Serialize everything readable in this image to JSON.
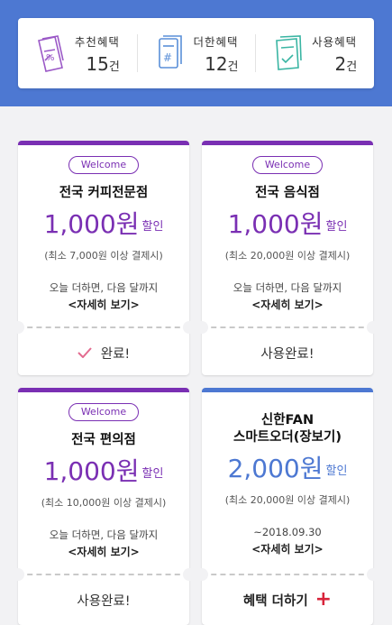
{
  "colors": {
    "header_blue": "#4d78d2",
    "purple": "#7a2fb3",
    "blue": "#4d78d2",
    "red": "#d8243b"
  },
  "summary": [
    {
      "label": "추천혜택",
      "count": "15",
      "unit": "건",
      "icon": "percent-ticket-icon",
      "color": "#9b59c7"
    },
    {
      "label": "더한혜택",
      "count": "12",
      "unit": "건",
      "icon": "hash-ticket-icon",
      "color": "#5a8fd8"
    },
    {
      "label": "사용혜택",
      "count": "2",
      "unit": "건",
      "icon": "check-ticket-icon",
      "color": "#3ab5a3"
    }
  ],
  "cards": [
    {
      "badge": "Welcome",
      "store": "전국 커피전문점",
      "amount": "1,000원",
      "discount": "할인",
      "minimum": "(최소 7,000원 이상 결제시)",
      "notice": "오늘 더하면, 다음 달까지",
      "detail": "<자세히 보기>",
      "footer": "완료!"
    },
    {
      "badge": "Welcome",
      "store": "전국 음식점",
      "amount": "1,000원",
      "discount": "할인",
      "minimum": "(최소 20,000원 이상 결제시)",
      "notice": "오늘 더하면, 다음 달까지",
      "detail": "<자세히 보기>",
      "footer": "사용완료!"
    },
    {
      "badge": "Welcome",
      "store": "전국 편의점",
      "amount": "1,000원",
      "discount": "할인",
      "minimum": "(최소 10,000원 이상 결제시)",
      "notice": "오늘 더하면, 다음 달까지",
      "detail": "<자세히 보기>",
      "footer": "사용완료!"
    },
    {
      "store_line1": "신한FAN",
      "store_line2": "스마트오더(장보기)",
      "amount": "2,000원",
      "discount": "할인",
      "minimum": "(최소 20,000원 이상 결제시)",
      "notice": "~2018.09.30",
      "detail": "<자세히 보기>",
      "footer": "혜택 더하기",
      "footer_icon": "+"
    }
  ]
}
